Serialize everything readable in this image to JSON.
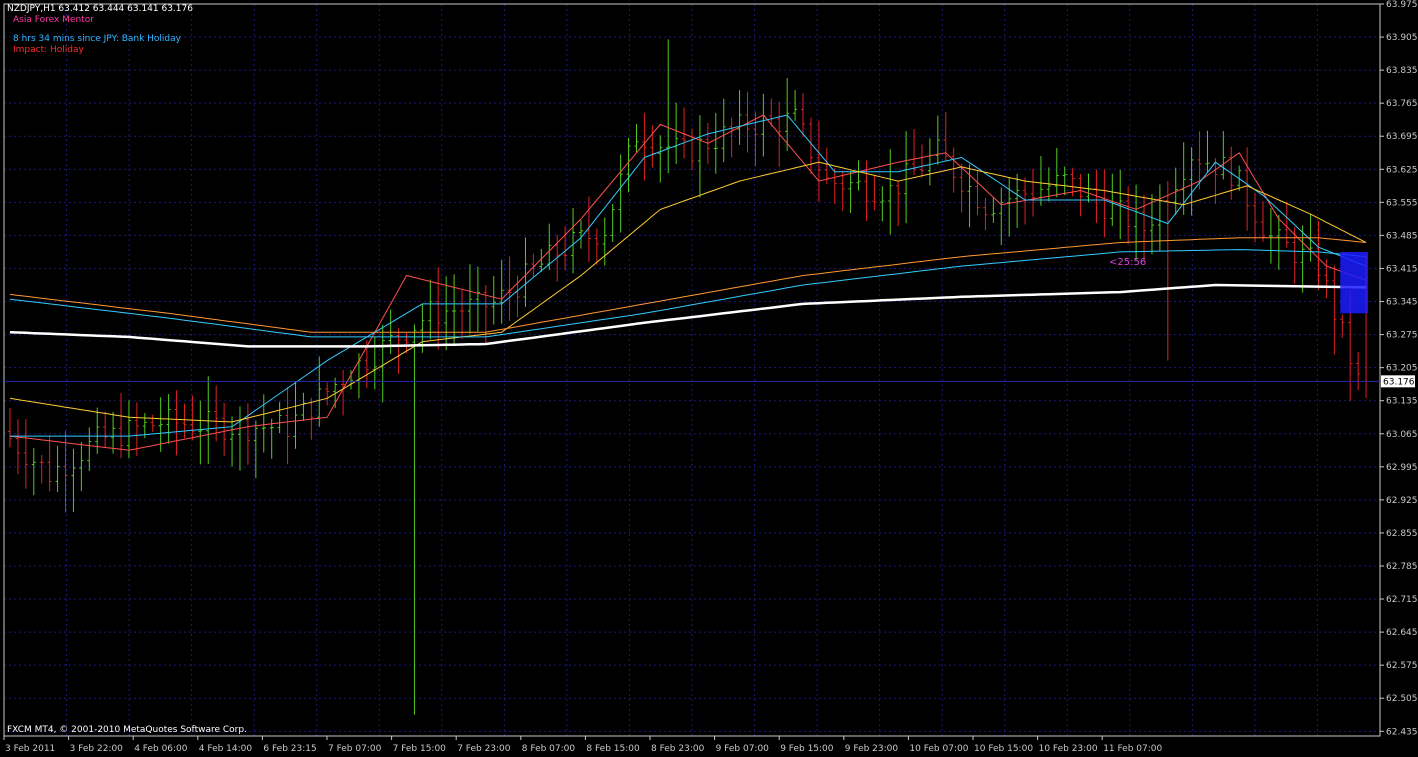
{
  "header": {
    "symbol_line": "NZDJPY,H1  63.412 63.444 63.141 63.176",
    "brand": "Asia Forex Mentor",
    "news": "8 hrs 34 mins since JPY: Bank Holiday",
    "impact": "Impact: Holiday"
  },
  "footer": {
    "copyright": "FXCM MT4, © 2001-2010 MetaQuotes Software Corp."
  },
  "countdown": "<25:56",
  "colors": {
    "background": "#000000",
    "grid": "#1b1b7a",
    "bull": "#55cc22",
    "bear": "#dd2222",
    "axis": "#c8c8c8",
    "price_tag_bg": "#ffffff",
    "price_line": "#2a2aaa",
    "ma_fast": "#ff5050",
    "ma_cyan": "#33ccff",
    "ma_yellow": "#ffcc33",
    "ma_orange": "#ff9933",
    "ma_white": "#ffffff",
    "highlight_box": "#1c1cff"
  },
  "chart_data": {
    "type": "candlestick",
    "symbol": "NZDJPY",
    "timeframe": "H1",
    "ohlc_last": {
      "open": 63.412,
      "high": 63.444,
      "low": 63.141,
      "close": 63.176
    },
    "current_price": 63.176,
    "ylim": [
      62.425,
      63.975
    ],
    "y_ticks": [
      63.975,
      63.905,
      63.835,
      63.765,
      63.695,
      63.625,
      63.555,
      63.485,
      63.415,
      63.345,
      63.275,
      63.205,
      63.135,
      63.065,
      62.995,
      62.925,
      62.855,
      62.785,
      62.715,
      62.645,
      62.575,
      62.505,
      62.435
    ],
    "x_ticks": [
      "3 Feb 2011",
      "3 Feb 22:00",
      "4 Feb 06:00",
      "4 Feb 14:00",
      "6 Feb 23:15",
      "7 Feb 07:00",
      "7 Feb 15:00",
      "7 Feb 23:00",
      "8 Feb 07:00",
      "8 Feb 15:00",
      "8 Feb 23:00",
      "9 Feb 07:00",
      "9 Feb 15:00",
      "9 Feb 23:00",
      "10 Feb 07:00",
      "10 Feb 15:00",
      "10 Feb 23:00",
      "11 Feb 07:00"
    ],
    "bar_count": 172,
    "grid": true,
    "series": [
      {
        "type": "moving-average",
        "color": "#ff5050",
        "anchors": [
          [
            0,
            63.06
          ],
          [
            15,
            63.03
          ],
          [
            30,
            63.08
          ],
          [
            40,
            63.1
          ],
          [
            50,
            63.4
          ],
          [
            62,
            63.35
          ],
          [
            72,
            63.52
          ],
          [
            82,
            63.72
          ],
          [
            88,
            63.68
          ],
          [
            95,
            63.74
          ],
          [
            102,
            63.6
          ],
          [
            112,
            63.64
          ],
          [
            118,
            63.66
          ],
          [
            125,
            63.55
          ],
          [
            135,
            63.58
          ],
          [
            142,
            63.54
          ],
          [
            150,
            63.6
          ],
          [
            155,
            63.66
          ],
          [
            160,
            63.52
          ],
          [
            166,
            63.42
          ],
          [
            171,
            63.39
          ]
        ]
      },
      {
        "type": "moving-average",
        "color": "#33ccff",
        "anchors": [
          [
            0,
            63.06
          ],
          [
            15,
            63.06
          ],
          [
            28,
            63.08
          ],
          [
            40,
            63.22
          ],
          [
            52,
            63.34
          ],
          [
            62,
            63.34
          ],
          [
            72,
            63.48
          ],
          [
            80,
            63.65
          ],
          [
            88,
            63.7
          ],
          [
            98,
            63.74
          ],
          [
            104,
            63.62
          ],
          [
            112,
            63.62
          ],
          [
            120,
            63.65
          ],
          [
            128,
            63.56
          ],
          [
            138,
            63.56
          ],
          [
            146,
            63.51
          ],
          [
            152,
            63.64
          ],
          [
            158,
            63.57
          ],
          [
            165,
            63.46
          ],
          [
            171,
            63.42
          ]
        ]
      },
      {
        "type": "moving-average",
        "color": "#ffcc33",
        "anchors": [
          [
            0,
            63.14
          ],
          [
            15,
            63.1
          ],
          [
            28,
            63.09
          ],
          [
            40,
            63.14
          ],
          [
            52,
            63.26
          ],
          [
            62,
            63.28
          ],
          [
            72,
            63.4
          ],
          [
            82,
            63.54
          ],
          [
            92,
            63.6
          ],
          [
            102,
            63.64
          ],
          [
            112,
            63.6
          ],
          [
            120,
            63.63
          ],
          [
            128,
            63.6
          ],
          [
            138,
            63.58
          ],
          [
            148,
            63.55
          ],
          [
            156,
            63.59
          ],
          [
            164,
            63.53
          ],
          [
            171,
            63.47
          ]
        ]
      },
      {
        "type": "moving-average",
        "color": "#ff9933",
        "anchors": [
          [
            0,
            63.36
          ],
          [
            20,
            63.32
          ],
          [
            38,
            63.28
          ],
          [
            60,
            63.28
          ],
          [
            80,
            63.34
          ],
          [
            100,
            63.4
          ],
          [
            120,
            63.44
          ],
          [
            140,
            63.47
          ],
          [
            155,
            63.48
          ],
          [
            165,
            63.48
          ],
          [
            171,
            63.47
          ]
        ]
      },
      {
        "type": "moving-average",
        "color": "#33ccff",
        "anchors": [
          [
            0,
            63.35
          ],
          [
            20,
            63.31
          ],
          [
            38,
            63.27
          ],
          [
            60,
            63.27
          ],
          [
            80,
            63.32
          ],
          [
            100,
            63.38
          ],
          [
            120,
            63.42
          ],
          [
            140,
            63.45
          ],
          [
            155,
            63.455
          ],
          [
            165,
            63.45
          ],
          [
            171,
            63.44
          ]
        ]
      },
      {
        "type": "moving-average",
        "color": "#ffffff",
        "bold": true,
        "anchors": [
          [
            0,
            63.28
          ],
          [
            15,
            63.27
          ],
          [
            30,
            63.25
          ],
          [
            45,
            63.25
          ],
          [
            60,
            63.255
          ],
          [
            80,
            63.3
          ],
          [
            100,
            63.34
          ],
          [
            120,
            63.355
          ],
          [
            140,
            63.365
          ],
          [
            152,
            63.38
          ],
          [
            171,
            63.375
          ]
        ]
      }
    ],
    "price_path": [
      [
        0,
        63.07
      ],
      [
        6,
        62.98
      ],
      [
        12,
        63.05
      ],
      [
        20,
        63.09
      ],
      [
        30,
        63.08
      ],
      [
        36,
        63.08
      ],
      [
        44,
        63.2
      ],
      [
        54,
        63.32
      ],
      [
        62,
        63.34
      ],
      [
        70,
        63.45
      ],
      [
        76,
        63.5
      ],
      [
        80,
        63.7
      ],
      [
        86,
        63.66
      ],
      [
        94,
        63.72
      ],
      [
        100,
        63.73
      ],
      [
        104,
        63.6
      ],
      [
        112,
        63.58
      ],
      [
        118,
        63.66
      ],
      [
        124,
        63.55
      ],
      [
        134,
        63.6
      ],
      [
        144,
        63.5
      ],
      [
        150,
        63.66
      ],
      [
        155,
        63.62
      ],
      [
        160,
        63.48
      ],
      [
        166,
        63.42
      ],
      [
        171,
        63.176
      ]
    ],
    "highlight": {
      "from_bar": 168,
      "to_bar": 171,
      "low": 63.32,
      "high": 63.45
    }
  }
}
